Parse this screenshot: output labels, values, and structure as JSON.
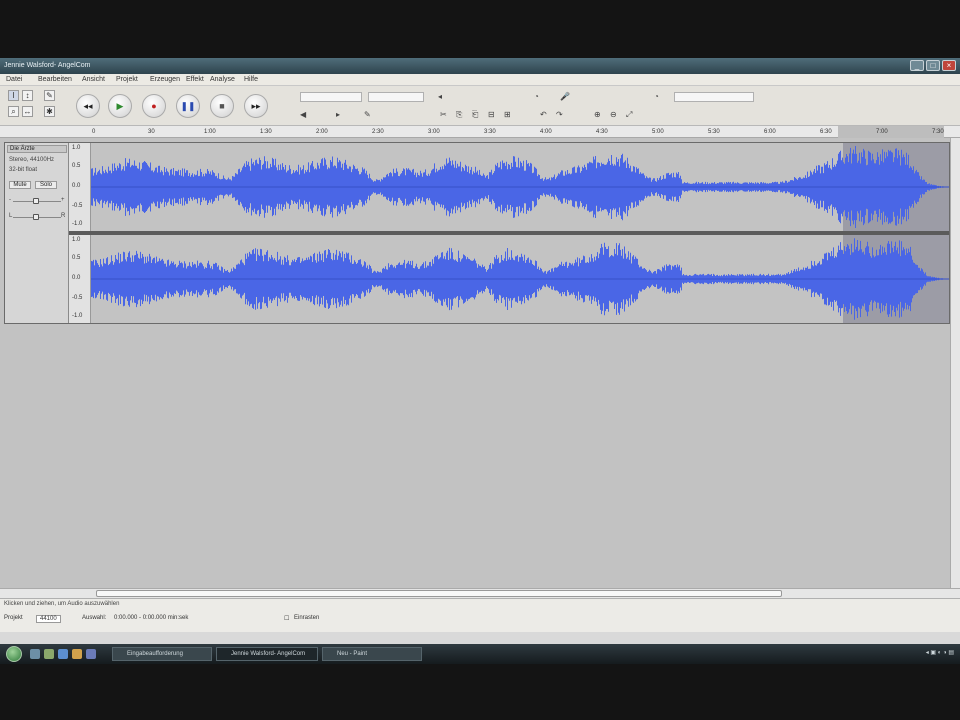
{
  "window": {
    "title": "Jennie Walsford- AngelCom",
    "buttons": [
      "_",
      "□",
      "×"
    ]
  },
  "menubar": {
    "items": [
      "Datei",
      "Bearbeiten",
      "Ansicht",
      "Projekt",
      "Erzeugen",
      "Effekt",
      "Analyse",
      "Hilfe"
    ]
  },
  "toolbar": {
    "tools": [
      "selection-tool",
      "envelope-tool",
      "draw-tool",
      "zoom-tool",
      "timeshift-tool",
      "multi-tool"
    ],
    "transport": [
      "skip-start",
      "play",
      "record",
      "pause",
      "stop",
      "skip-end"
    ],
    "transport_glyphs": [
      "◂◂",
      "▶",
      "●",
      "❚❚",
      "■",
      "▸▸"
    ],
    "edit_glyphs": [
      "✂",
      "⎘",
      "⎗",
      "⊟",
      "⊞",
      "↶",
      "↷",
      "⊕",
      "⊖",
      "⤢"
    ]
  },
  "ruler": {
    "ticks": [
      "0",
      "30",
      "1:00",
      "1:30",
      "2:00",
      "2:30",
      "3:00",
      "3:30",
      "4:00",
      "4:30",
      "5:00",
      "5:30",
      "6:00",
      "6:30",
      "7:00",
      "7:30"
    ]
  },
  "track": {
    "name": "Die Ärzte",
    "info_lines": [
      "Stereo, 44100Hz",
      "32-bit float"
    ],
    "mute_label": "Mute",
    "solo_label": "Solo",
    "gain_left": "-",
    "gain_right": "+",
    "pan_left": "L",
    "pan_right": "R",
    "scale_labels": [
      "1.0",
      "0.5",
      "0.0",
      "-0.5",
      "-1.0"
    ]
  },
  "status": {
    "message": "Klicken und ziehen, um Audio auszuwählen",
    "project_rate_label": "Projekt",
    "project_rate_value": "44100",
    "selection_label": "Auswahl:",
    "selection_value": "0:00.000 - 0:00.000 min:sek",
    "snap_label": "Einrasten"
  },
  "taskbar": {
    "tasks": [
      "Eingabeaufforderung",
      "Jennie Walsford- AngelCom",
      "Neu - Paint"
    ]
  },
  "colors": {
    "waveform": "#4a66e6",
    "waveform_dark": "#3650c8",
    "selection": "#9c9ca6"
  }
}
